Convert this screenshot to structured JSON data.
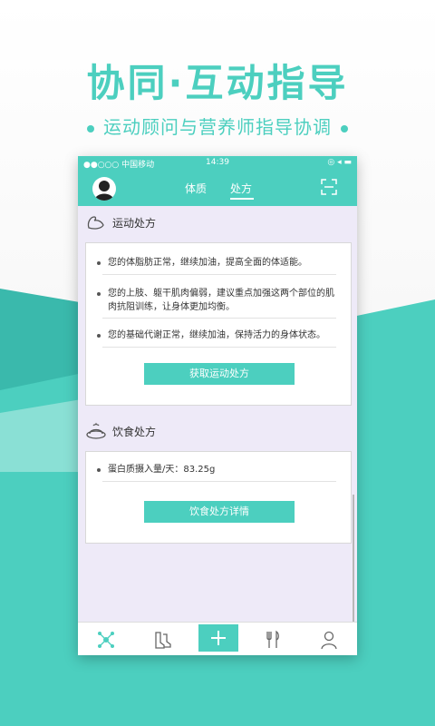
{
  "promo": {
    "headline": "协同·互动指导",
    "subline": "运动顾问与营养师指导协调"
  },
  "status_bar": {
    "carrier": "●●○○○ 中国移动 ",
    "time": "14:39",
    "right": "◎ ◂ ▬"
  },
  "nav": {
    "tabs": [
      "体质",
      "处方"
    ],
    "active_tab": "处方"
  },
  "exercise": {
    "title": "运动处方",
    "items": [
      "您的体脂肪正常，继续加油，提高全面的体适能。",
      "您的上肢、躯干肌肉偏弱，建议重点加强这两个部位的肌肉抗阻训练，让身体更加均衡。",
      "您的基础代谢正常，继续加油，保持活力的身体状态。"
    ],
    "button": "获取运动处方"
  },
  "diet": {
    "title": "饮食处方",
    "items": [
      "蛋白质摄入量/天：83.25g"
    ],
    "button": "饮食处方详情"
  },
  "bottom_nav": [
    "molecule-icon",
    "boots-icon",
    "plus-icon",
    "fork-knife-icon",
    "person-icon"
  ],
  "colors": {
    "accent": "#4ccfbf",
    "content_bg": "#eeeaf8"
  }
}
